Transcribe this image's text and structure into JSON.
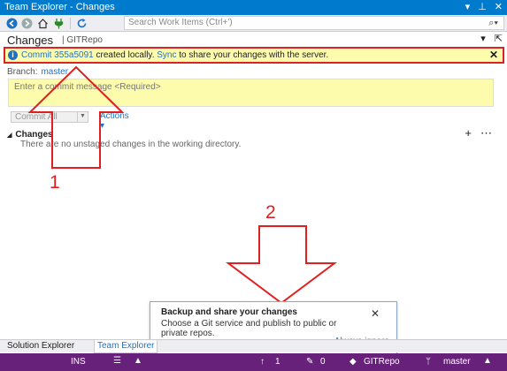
{
  "window": {
    "title": "Team Explorer - Changes",
    "title_icons": [
      "▾",
      "⊥",
      "✕"
    ]
  },
  "toolbar": {
    "search_placeholder": "Search Work Items (Ctrl+')",
    "search_icon": "search-icon"
  },
  "header": {
    "title": "Changes",
    "repo": "| GITRepo"
  },
  "info_bar": {
    "prefix": "Commit ",
    "commit_id": "355a5091",
    "middle": " created locally. ",
    "sync": "Sync",
    "suffix": " to share your changes with the server."
  },
  "branch": {
    "label": "Branch:",
    "value": "master"
  },
  "commit": {
    "placeholder": "Enter a commit message <Required>",
    "button": "Commit All",
    "actions": "Actions"
  },
  "changes": {
    "heading": "Changes",
    "empty_message": "There are no unstaged changes in the working directory."
  },
  "annotations": {
    "one": "1",
    "two": "2",
    "color": "#e02020"
  },
  "popup": {
    "title": "Backup and share your changes",
    "body": "Choose a Git service and publish to public or private repos.",
    "link": "Always ignore"
  },
  "bottom_tabs": [
    "Solution Explorer",
    "Team Explorer"
  ],
  "statusbar": {
    "ins": "INS",
    "push_count": "1",
    "pending_count": "0",
    "repo": "GITRepo",
    "branch": "master",
    "color": "#68217a"
  }
}
